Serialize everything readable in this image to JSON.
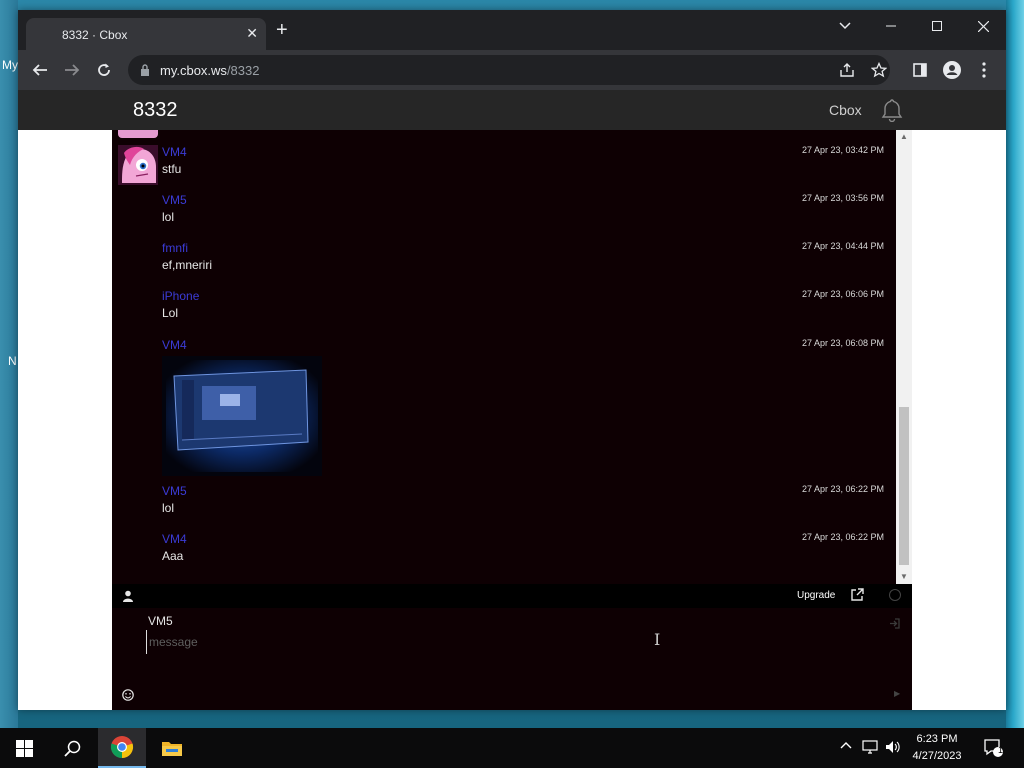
{
  "desktop": {
    "label_top": "My",
    "label_mid": "N"
  },
  "browser": {
    "tab_title": "8332 · Cbox",
    "url_host": "my.cbox.ws",
    "url_path": "/8332"
  },
  "site": {
    "title": "8332",
    "brand": "Cbox"
  },
  "messages": [
    {
      "user": "VM4",
      "text": "stfu",
      "date": "27 Apr 23, 03:42 PM",
      "avatar": true
    },
    {
      "user": "VM5",
      "text": "lol",
      "date": "27 Apr 23, 03:56 PM"
    },
    {
      "user": "fmnfi",
      "text": "ef,mneriri",
      "date": "27 Apr 23, 04:44 PM"
    },
    {
      "user": "iPhone",
      "text": "Lol",
      "date": "27 Apr 23, 06:06 PM"
    },
    {
      "user": "VM4",
      "text": "",
      "date": "27 Apr 23, 06:08 PM",
      "image": "screenshot-photo"
    },
    {
      "user": "VM5",
      "text": "lol",
      "date": "27 Apr 23, 06:22 PM"
    },
    {
      "user": "VM4",
      "text": "Aaa",
      "date": "27 Apr 23, 06:22 PM"
    }
  ],
  "cbox_bar": {
    "upgrade_label": "Upgrade"
  },
  "composer": {
    "name": "VM5",
    "placeholder": "message",
    "value": ""
  },
  "taskbar": {
    "time": "6:23 PM",
    "date": "4/27/2023",
    "notification_count": "1"
  },
  "colors": {
    "username": "#3b3bd6",
    "chat_bg": "#0e0003",
    "header_bg": "#262626"
  }
}
